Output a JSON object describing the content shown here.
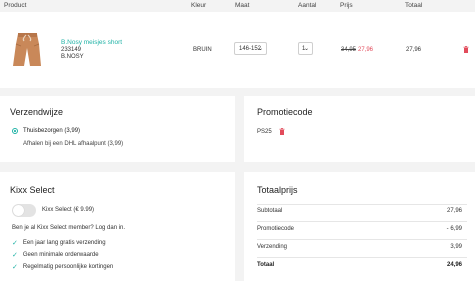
{
  "table": {
    "headers": {
      "product": "Product",
      "color": "Kleur",
      "size": "Maat",
      "qty": "Aantal",
      "price": "Prijs",
      "total": "Totaal"
    },
    "item": {
      "name": "B.Nosy meisjes short",
      "sku": "233149",
      "brand": "B.NOSY",
      "color": "BRUIN",
      "size": "146-152",
      "qty": "1",
      "old_price": "34,95",
      "new_price": "27,96",
      "total": "27,96"
    }
  },
  "shipping": {
    "title": "Verzendwijze",
    "options": [
      {
        "label": "Thuisbezorgen (3,99)",
        "selected": true
      },
      {
        "label": "Afhalen bij een DHL afhaalpunt (3,99)",
        "selected": false
      }
    ]
  },
  "promo": {
    "title": "Promotiecode",
    "code": "PS25"
  },
  "kixx": {
    "title": "Kixx Select",
    "toggle_label": "Kixx Select (€ 9.99)",
    "question": "Ben je al Kixx Select member? Log dan in.",
    "benefits": [
      "Een jaar lang gratis verzending",
      "Geen minimale orderwaarde",
      "Regelmatig persoonlijke kortingen"
    ]
  },
  "totals": {
    "title": "Totaalprijs",
    "rows": [
      {
        "label": "Subtotaal",
        "value": "27,96"
      },
      {
        "label": "Promotiecode",
        "value": "- 6,99"
      },
      {
        "label": "Verzending",
        "value": "3,99"
      },
      {
        "label": "Totaal",
        "value": "24,96"
      }
    ]
  },
  "colors": {
    "accent": "#1fb2a6",
    "danger": "#e24b5b"
  }
}
